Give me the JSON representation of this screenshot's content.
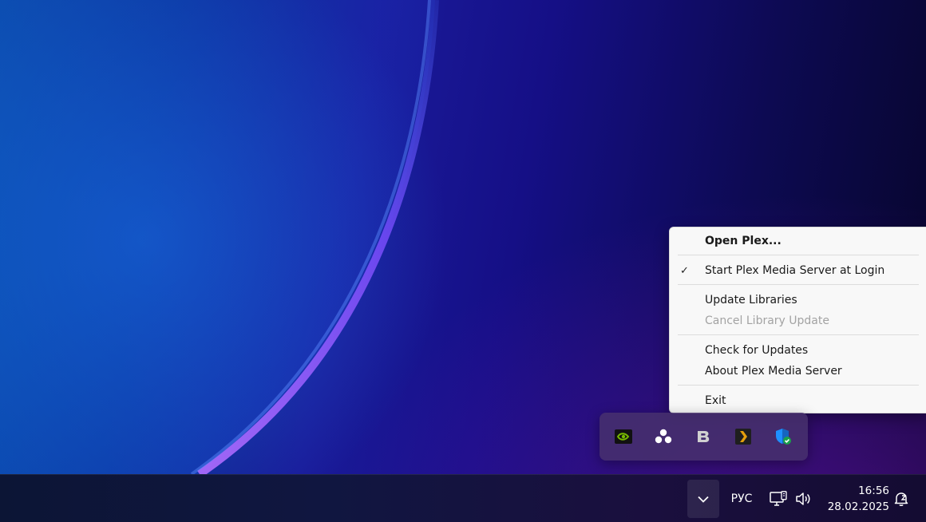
{
  "context_menu": {
    "items": [
      {
        "label": "Open Plex...",
        "bold": true,
        "checked": false,
        "enabled": true
      },
      {
        "label": "Start Plex Media Server at Login",
        "bold": false,
        "checked": true,
        "enabled": true
      },
      {
        "label": "Update Libraries",
        "bold": false,
        "checked": false,
        "enabled": true
      },
      {
        "label": "Cancel Library Update",
        "bold": false,
        "checked": false,
        "enabled": false
      },
      {
        "label": "Check for Updates",
        "bold": false,
        "checked": false,
        "enabled": true
      },
      {
        "label": "About Plex Media Server",
        "bold": false,
        "checked": false,
        "enabled": true
      },
      {
        "label": "Exit",
        "bold": false,
        "checked": false,
        "enabled": true
      }
    ],
    "check_glyph": "✓"
  },
  "tray_overflow": {
    "icons": [
      {
        "name": "nvidia-icon",
        "color": "#76b900"
      },
      {
        "name": "app-cluster-icon",
        "color": "#ffffff"
      },
      {
        "name": "b-app-icon",
        "color": "#d0d0d0"
      },
      {
        "name": "plex-icon",
        "color": "#e5a00d"
      },
      {
        "name": "windows-security-icon",
        "color": "#1e90ff"
      }
    ]
  },
  "taskbar": {
    "language": "РУС",
    "time": "16:56",
    "date": "28.02.2025",
    "icons": [
      "chevron-up-icon",
      "network-icon",
      "volume-icon",
      "notification-bell-icon"
    ]
  }
}
